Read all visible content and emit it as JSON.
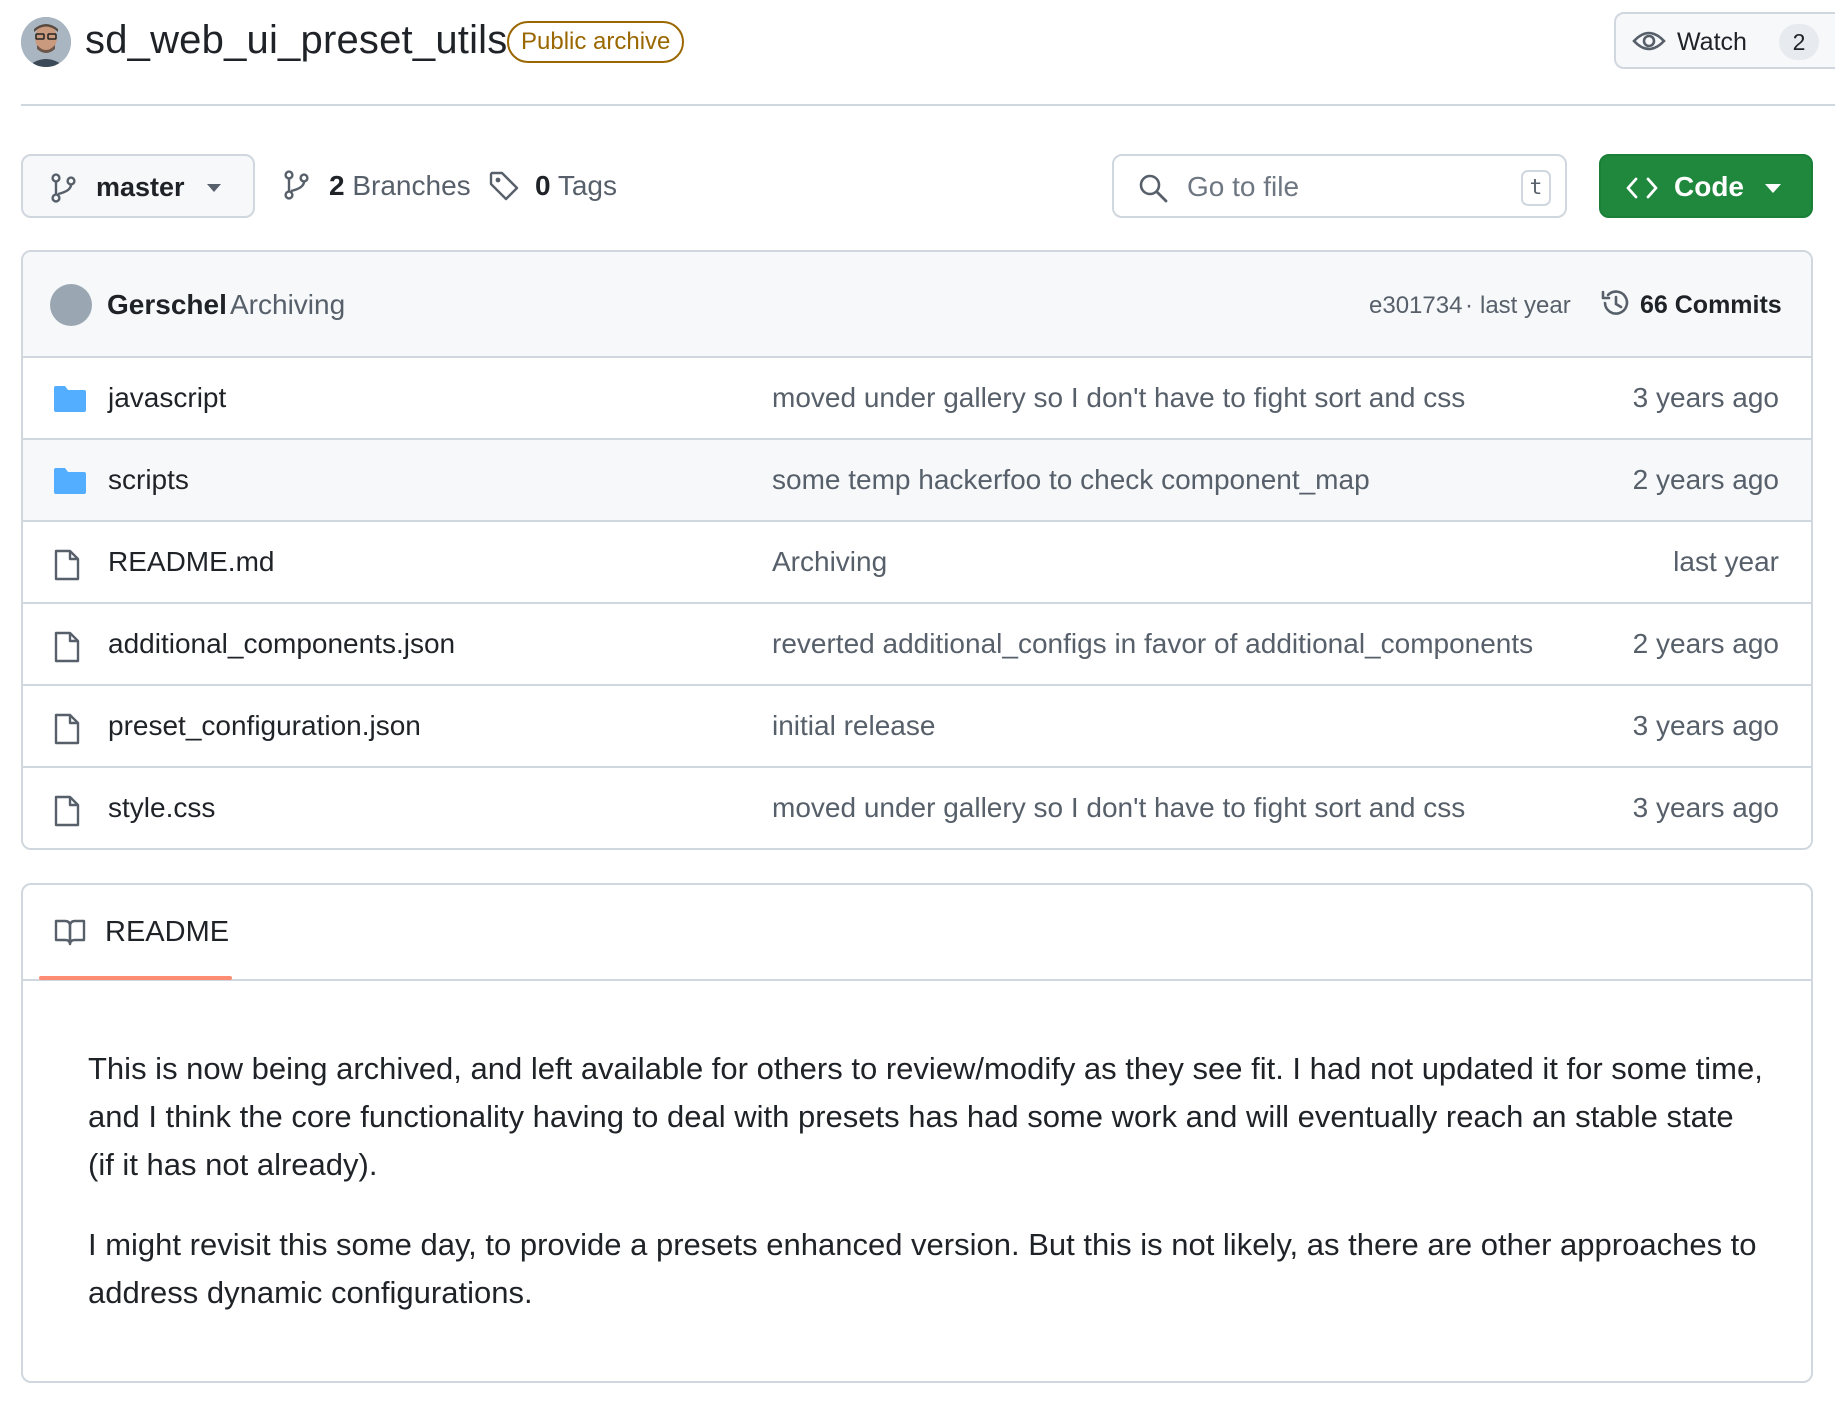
{
  "repo": {
    "name": "sd_web_ui_preset_utils",
    "badge": "Public archive",
    "watch_label": "Watch",
    "watch_count": "2"
  },
  "toolbar": {
    "branch": "master",
    "branches_count": "2",
    "branches_label": "Branches",
    "tags_count": "0",
    "tags_label": "Tags",
    "search_placeholder": "Go to file",
    "search_shortcut": "t",
    "code_label": "Code",
    "colors": {
      "code_button": "#1f883d",
      "archive_badge": "#9a6700",
      "folder": "#54aeff"
    }
  },
  "latest_commit": {
    "author": "Gerschel",
    "message": "Archiving",
    "sha": "e301734",
    "separator": "·",
    "when": "last year",
    "commits_label": "66 Commits"
  },
  "files": [
    {
      "type": "folder",
      "name": "javascript",
      "message": "moved under gallery so I don't have to fight sort and css",
      "age": "3 years ago"
    },
    {
      "type": "folder",
      "name": "scripts",
      "message": "some temp hackerfoo to check component_map",
      "age": "2 years ago"
    },
    {
      "type": "file",
      "name": "README.md",
      "message": "Archiving",
      "age": "last year"
    },
    {
      "type": "file",
      "name": "additional_components.json",
      "message": "reverted additional_configs in favor of additional_components",
      "age": "2 years ago"
    },
    {
      "type": "file",
      "name": "preset_configuration.json",
      "message": "initial release",
      "age": "3 years ago"
    },
    {
      "type": "file",
      "name": "style.css",
      "message": "moved under gallery so I don't have to fight sort and css",
      "age": "3 years ago"
    }
  ],
  "readme": {
    "tab_label": "README",
    "paragraphs": [
      "This is now being archived, and left available for others to review/modify as they see fit. I had not updated it for some time, and I think the core functionality having to deal with presets has had some work and will eventually reach an stable state (if it has not already).",
      "I might revisit this some day, to provide a presets enhanced version. But this is not likely, as there are other approaches to address dynamic configurations."
    ]
  }
}
